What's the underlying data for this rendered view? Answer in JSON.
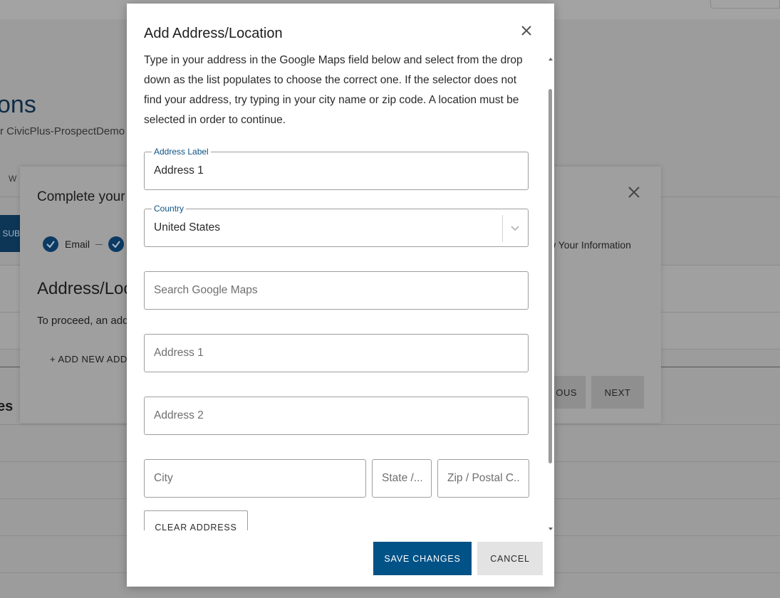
{
  "background": {
    "heading_fragment": "ons",
    "sub_fragment": "r CivicPlus-ProspectDemo",
    "tab_fragment": "W",
    "submit_fragment": "SUB",
    "section_fragment": "es"
  },
  "underlying_modal": {
    "title": "Complete your",
    "steps": {
      "step1_label": "Email",
      "last_step_label": "w Your Information"
    },
    "heading": "Address/Loc",
    "paragraph": "To proceed, an add",
    "add_link": "+ ADD NEW ADD",
    "previous_label": "OUS",
    "next_label": "NEXT"
  },
  "dialog": {
    "title": "Add Address/Location",
    "intro": "Type in your address in the Google Maps field below and select from the drop down as the list populates to choose the correct one. If the selector does not find your address, try typing in your city name or zip code. A location must be selected in order to continue.",
    "address_label": {
      "label": "Address Label",
      "value": "Address 1"
    },
    "country": {
      "label": "Country",
      "value": "United States"
    },
    "search_placeholder": "Search Google Maps",
    "address1_placeholder": "Address 1",
    "address2_placeholder": "Address 2",
    "city_placeholder": "City",
    "state_placeholder": "State /...",
    "zip_placeholder": "Zip / Postal C...",
    "clear_label": "CLEAR ADDRESS",
    "save_label": "SAVE CHANGES",
    "cancel_label": "CANCEL"
  },
  "colors": {
    "primary": "#005287",
    "label_blue": "#0d5385",
    "overlay_gray": "#9c9c9c"
  }
}
